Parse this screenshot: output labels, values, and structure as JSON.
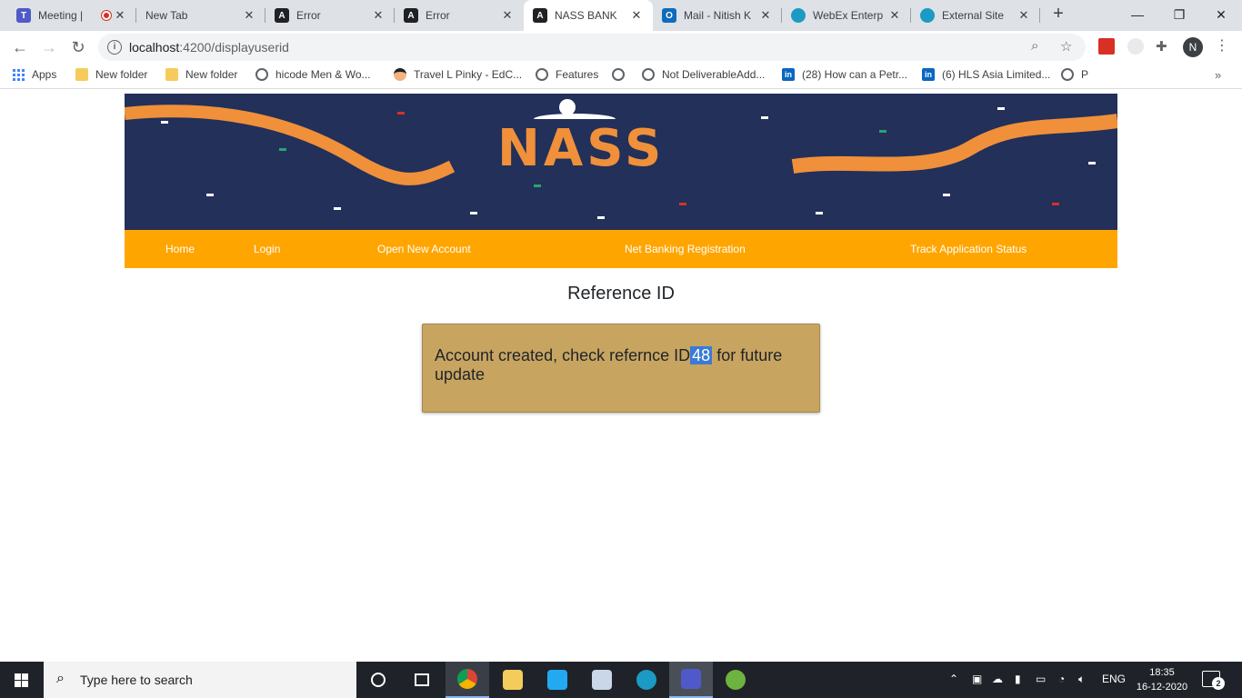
{
  "browser": {
    "tabs": [
      {
        "title": "Meeting |",
        "icon": "teams-icon",
        "color": "#5059c9",
        "recording": true
      },
      {
        "title": "New Tab",
        "icon": "none"
      },
      {
        "title": "Error",
        "icon": "angular-icon",
        "color": "#202124"
      },
      {
        "title": "Error",
        "icon": "angular-icon",
        "color": "#202124"
      },
      {
        "title": "NASS BANK",
        "icon": "angular-icon",
        "color": "#202124",
        "active": true
      },
      {
        "title": "Mail - Nitish K",
        "icon": "outlook-icon",
        "color": "#0f6cbd"
      },
      {
        "title": "WebEx Enterp",
        "icon": "webex-icon",
        "color": "#1b9bc3"
      },
      {
        "title": "External Site",
        "icon": "webex-icon",
        "color": "#1b9bc3"
      }
    ],
    "url_host": "localhost",
    "url_path": ":4200/displayuserid",
    "profile_initial": "N",
    "bookmarks": [
      {
        "label": "Apps",
        "icon": "apps-icon"
      },
      {
        "label": "New folder",
        "icon": "folder-icon"
      },
      {
        "label": "New folder",
        "icon": "folder-icon"
      },
      {
        "label": "hicode Men & Wo...",
        "icon": "globe-icon"
      },
      {
        "label": "Travel L Pinky - EdC...",
        "icon": "avatar-icon"
      },
      {
        "label": "Features",
        "icon": "globe-icon"
      },
      {
        "label": "",
        "icon": "globe-icon"
      },
      {
        "label": "Not DeliverableAdd...",
        "icon": "globe-icon"
      },
      {
        "label": "(28) How can a Petr...",
        "icon": "linkedin-icon"
      },
      {
        "label": "(6) HLS Asia Limited...",
        "icon": "linkedin-icon"
      },
      {
        "label": "P",
        "icon": "globe-icon"
      }
    ]
  },
  "page": {
    "logo_text": "NASS",
    "nav": [
      "Home",
      "Login",
      "Open New Account",
      "Net Banking Registration",
      "Track Application Status"
    ],
    "title": "Reference ID",
    "message_before": "Account created, check refernce ID",
    "reference_id": "48",
    "message_after": "for future update",
    "colors": {
      "navbar": "#ffa500",
      "banner": "#22305a",
      "message_bg": "#c8a461"
    }
  },
  "taskbar": {
    "search_placeholder": "Type here to search",
    "language": "ENG",
    "time": "18:35",
    "date": "16-12-2020",
    "notifications": "2"
  }
}
